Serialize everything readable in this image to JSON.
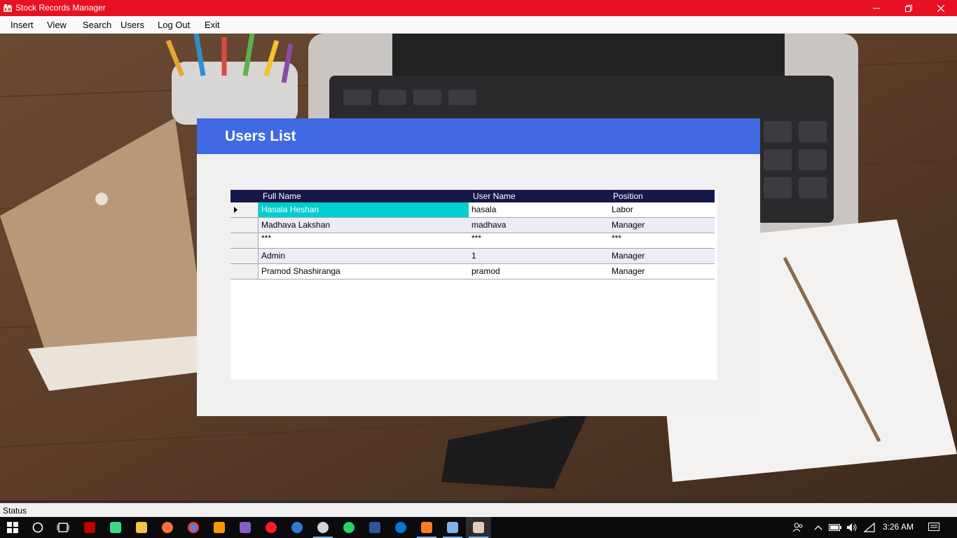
{
  "window": {
    "title": "Stock Records Manager"
  },
  "menu": {
    "insert": "Insert",
    "view": "View",
    "search": "Search",
    "users": "Users",
    "logout": "Log Out",
    "exit": "Exit"
  },
  "panel": {
    "title": "Users List",
    "header_color": "#4169e1"
  },
  "grid": {
    "columns": [
      "Full Name",
      "User Name",
      "Position"
    ],
    "rows": [
      {
        "full_name": "Hasala Heshan",
        "user_name": "hasala",
        "position": "Labor"
      },
      {
        "full_name": "Madhava Lakshan",
        "user_name": "madhava",
        "position": "Manager"
      },
      {
        "full_name": "***",
        "user_name": "***",
        "position": "***"
      },
      {
        "full_name": "Admin",
        "user_name": "1",
        "position": "Manager"
      },
      {
        "full_name": "Pramod Shashiranga",
        "user_name": "pramod",
        "position": "Manager"
      }
    ],
    "selected_color": "#00cfcf",
    "header_color": "#16184a"
  },
  "statusbar": {
    "text": "Status"
  },
  "taskbar": {
    "clock": "3:26 AM",
    "apps": [
      "windows-start-icon",
      "cortana-icon",
      "task-view-icon",
      "filezilla-icon",
      "android-studio-icon",
      "file-explorer-icon",
      "firefox-icon",
      "chrome-icon",
      "sublime-icon",
      "visual-studio-icon",
      "opera-icon",
      "firefox-dev-icon",
      "settings-icon",
      "whatsapp-icon",
      "word-icon",
      "edge-icon",
      "xampp-icon",
      "paint-icon",
      "stock-manager-icon"
    ]
  },
  "colors": {
    "titlebar": "#e81123"
  }
}
